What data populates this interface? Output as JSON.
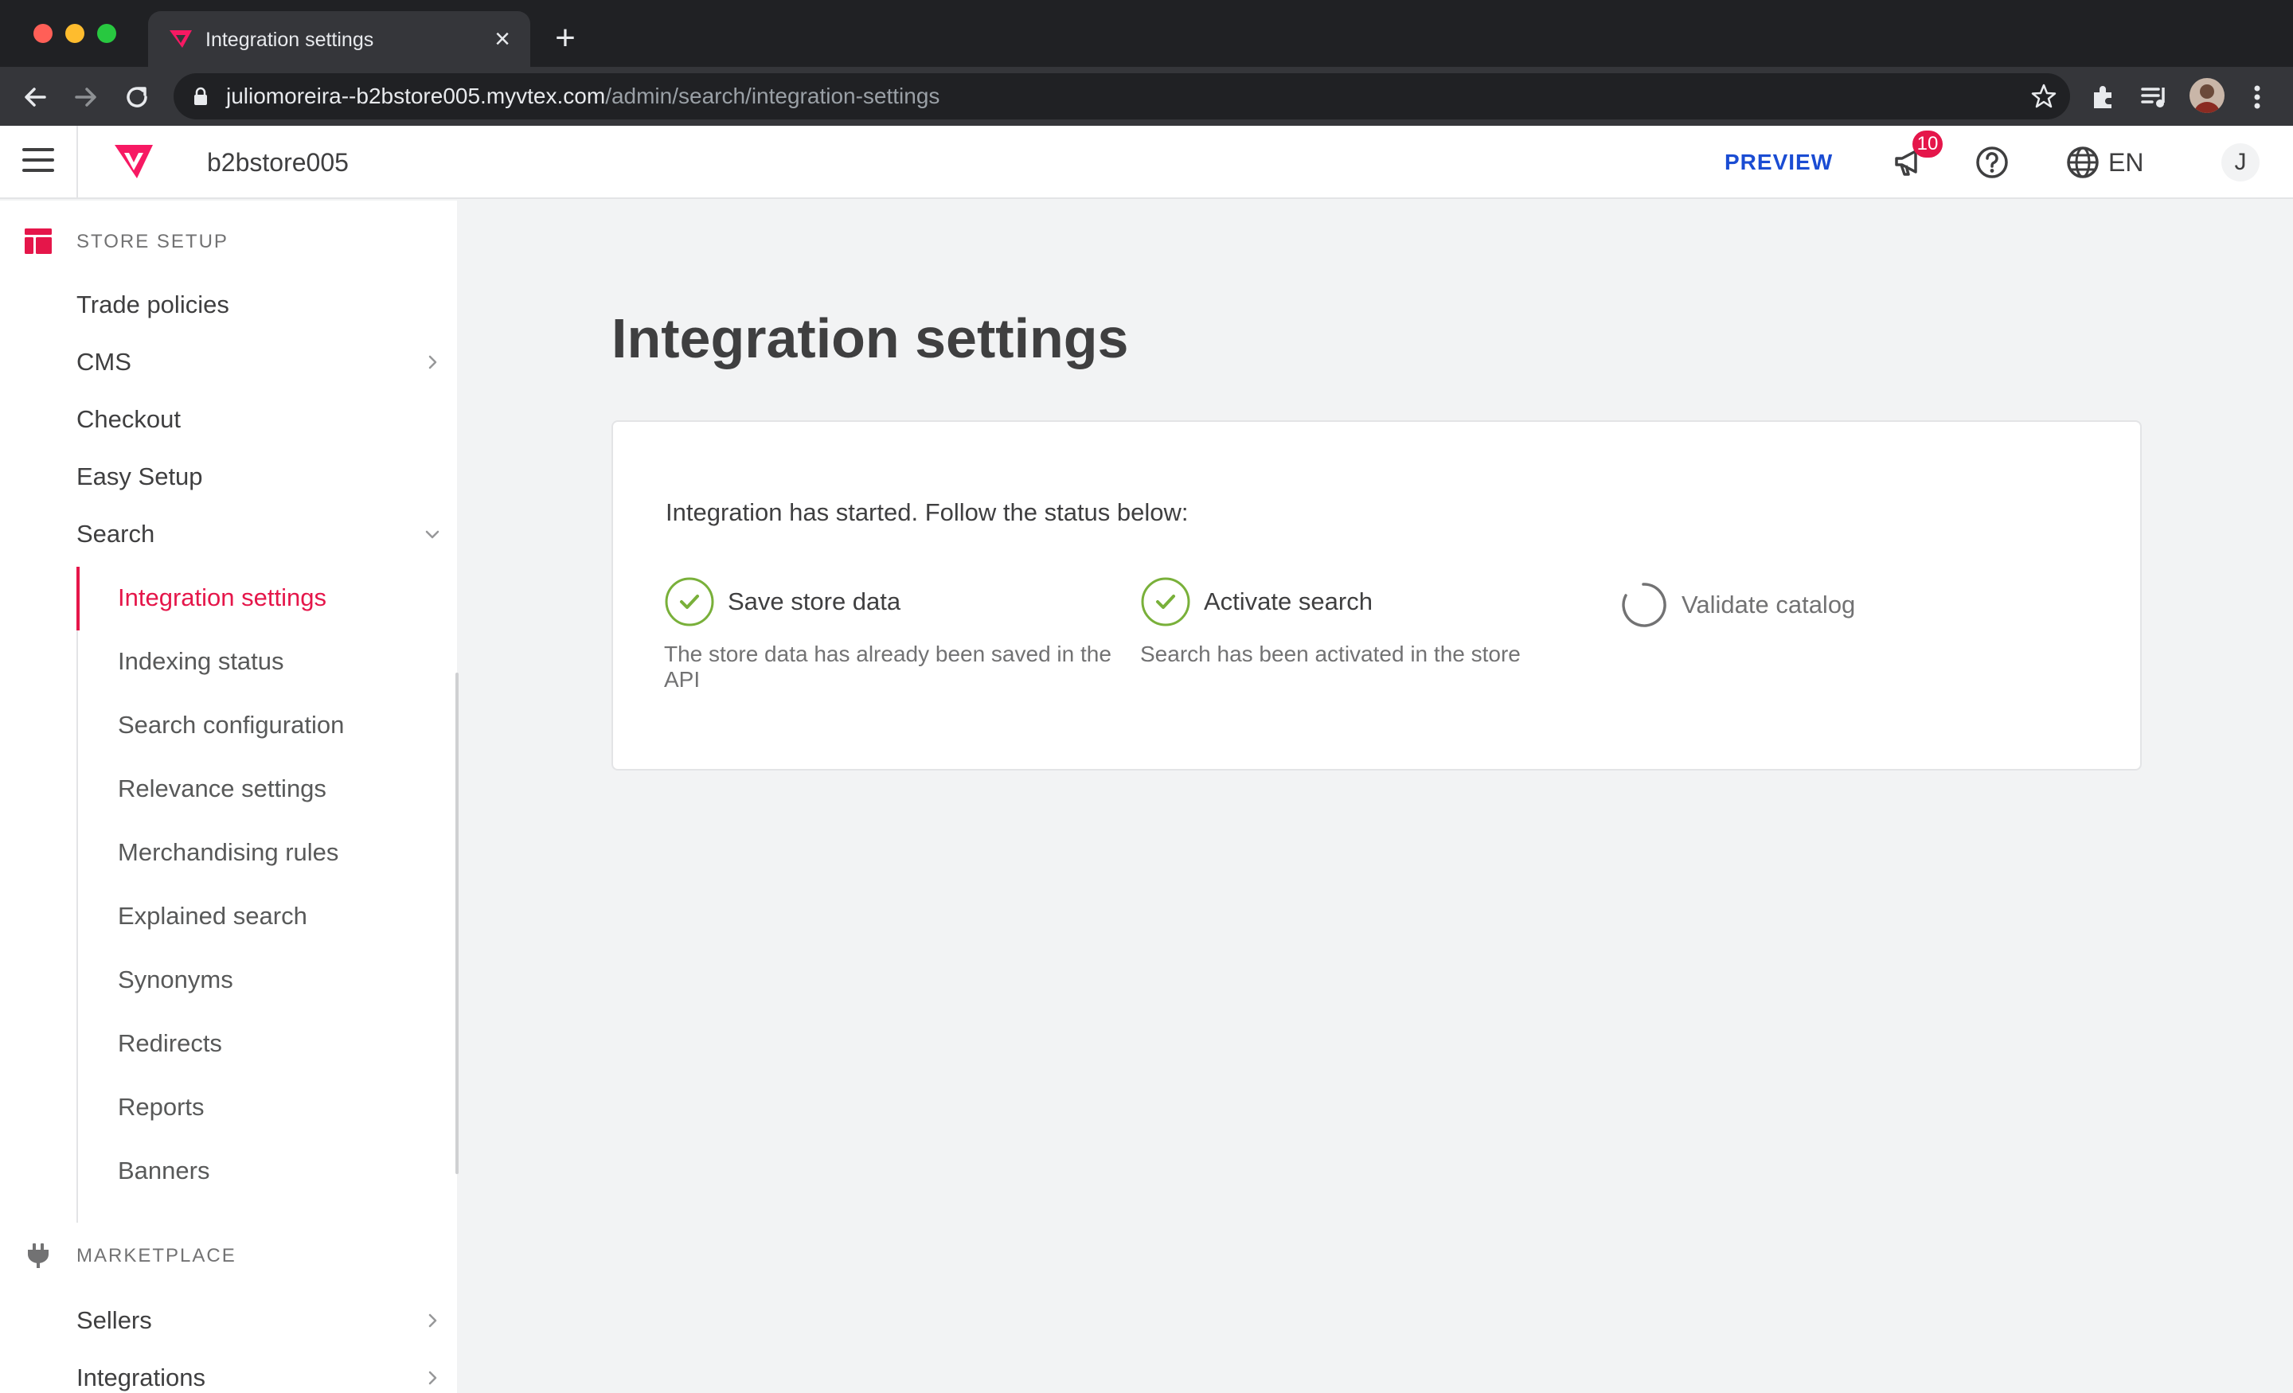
{
  "browser": {
    "tab_title": "Integration settings",
    "tab_close": "×",
    "new_tab": "+",
    "url_host": "juliomoreira--b2bstore005.myvtex.com",
    "url_path": "/admin/search/integration-settings"
  },
  "header": {
    "store_name": "b2bstore005",
    "preview_label": "PREVIEW",
    "notification_count": "10",
    "language": "EN",
    "user_initial": "J"
  },
  "sidebar": {
    "store_setup_label": "STORE SETUP",
    "items": [
      {
        "label": "Trade policies"
      },
      {
        "label": "CMS"
      },
      {
        "label": "Checkout"
      },
      {
        "label": "Easy Setup"
      },
      {
        "label": "Search"
      }
    ],
    "search_subitems": [
      {
        "label": "Integration settings",
        "active": true
      },
      {
        "label": "Indexing status"
      },
      {
        "label": "Search configuration"
      },
      {
        "label": "Relevance settings"
      },
      {
        "label": "Merchandising rules"
      },
      {
        "label": "Explained search"
      },
      {
        "label": "Synonyms"
      },
      {
        "label": "Redirects"
      },
      {
        "label": "Reports"
      },
      {
        "label": "Banners"
      }
    ],
    "marketplace_label": "MARKETPLACE",
    "marketplace_items": [
      {
        "label": "Sellers"
      },
      {
        "label": "Integrations"
      }
    ]
  },
  "main": {
    "title": "Integration settings",
    "intro": "Integration has started. Follow the status below:",
    "steps": [
      {
        "title": "Save store data",
        "description": "The store data has already been saved in the API",
        "status": "done"
      },
      {
        "title": "Activate search",
        "description": "Search has been activated in the store",
        "status": "done"
      },
      {
        "title": "Validate catalog",
        "description": "",
        "status": "loading"
      }
    ]
  },
  "colors": {
    "accent": "#e5164a",
    "link_blue": "#1a4cd3",
    "success_green": "#79b03a",
    "text": "#3f3f40",
    "muted": "#727273",
    "background": "#f2f3f4"
  }
}
